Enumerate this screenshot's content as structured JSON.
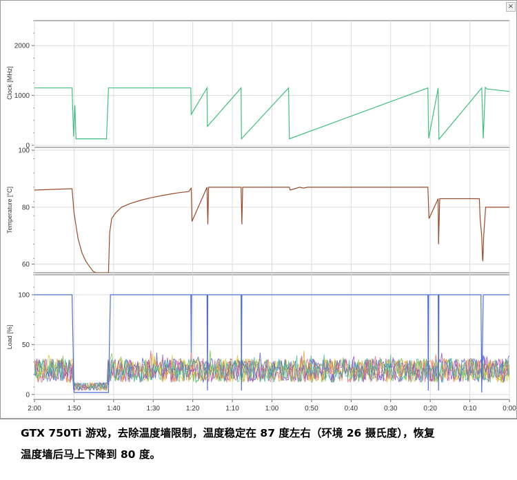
{
  "close_label": "×",
  "caption": {
    "line1": "GTX 750Ti 游戏，去除温度墙限制，温度稳定在 87 度左右（环境 26 摄氏度），恢复",
    "line2": "温度墙后马上下降到 80 度。"
  },
  "chart_data": [
    {
      "type": "line",
      "ylabel": "Clock [MHz]",
      "ylim": [
        0,
        2500
      ],
      "yticks": [
        0,
        1000,
        2000
      ],
      "color": "#3fbf7f",
      "x": [
        120,
        110.5,
        110.1,
        109.8,
        109.5,
        101.8,
        101.3,
        80.5,
        80.4,
        76.4,
        76.3,
        67.8,
        67.7,
        55.8,
        55.6,
        20.6,
        20.4,
        18.0,
        17.8,
        7.0,
        6.6,
        6.1,
        5.6,
        0
      ],
      "y": [
        1150,
        1150,
        180,
        800,
        130,
        130,
        1150,
        1150,
        620,
        1150,
        380,
        1150,
        130,
        1150,
        130,
        1150,
        140,
        1150,
        120,
        1150,
        140,
        1160,
        1130,
        1080
      ]
    },
    {
      "type": "line",
      "ylabel": "Temperature [°C]",
      "ylim": [
        57,
        101
      ],
      "yticks": [
        60,
        80,
        100
      ],
      "color": "#9a4a28",
      "x": [
        120,
        110.5,
        110.0,
        109.0,
        108.0,
        107.0,
        106.0,
        105.2,
        104.5,
        101.3,
        101.0,
        100.5,
        99.5,
        98.0,
        96.0,
        93.0,
        90.0,
        87.0,
        84.0,
        81.0,
        80.5,
        80.4,
        80.2,
        76.4,
        76.2,
        76.0,
        67.8,
        67.6,
        67.4,
        55.7,
        55.6,
        55.4,
        53.0,
        52.0,
        51.0,
        50.0,
        49.0,
        46.0,
        20.6,
        20.5,
        20.3,
        18.0,
        17.9,
        17.6,
        7.6,
        7.4,
        7.0,
        6.8,
        6.7,
        6.5,
        6.0,
        0
      ],
      "y": [
        86,
        86.5,
        78,
        69,
        64,
        61,
        59,
        57.5,
        57,
        57,
        71,
        76,
        78,
        80,
        81.2,
        82.5,
        83.5,
        84.3,
        85,
        85.5,
        86.5,
        86.8,
        75,
        87,
        74,
        87,
        87,
        74,
        87,
        87,
        87,
        86,
        87,
        86.7,
        87,
        87,
        87,
        87,
        87,
        83,
        76,
        83,
        67,
        83,
        83,
        76,
        70,
        62,
        61,
        70,
        80,
        80
      ]
    },
    {
      "type": "line",
      "ylabel": "Load [%]",
      "ylim": [
        -5,
        120
      ],
      "yticks": [
        0,
        50,
        100
      ],
      "color": "#4a6fd4",
      "noise_colors": [
        "#e8a030",
        "#7ac043",
        "#9b3fd0",
        "#d9c62e",
        "#4f5fcf",
        "#e86a7a",
        "#3fbfa0"
      ],
      "x": [
        120,
        110.5,
        110.0,
        101.3,
        100.8,
        80.5,
        80.4,
        80.3,
        76.4,
        76.3,
        76.2,
        67.8,
        67.7,
        67.6,
        20.6,
        20.5,
        20.4,
        18.0,
        17.9,
        17.8,
        7.2,
        7.0,
        6.6,
        6.4,
        0
      ],
      "y": [
        100,
        100,
        2,
        2,
        100,
        100,
        42,
        100,
        100,
        4,
        100,
        100,
        4,
        100,
        100,
        4,
        100,
        100,
        4,
        100,
        100,
        2,
        100,
        100,
        100
      ]
    }
  ],
  "x_axis": {
    "range_seconds": [
      120,
      0
    ],
    "tick_values": [
      120,
      110,
      100,
      90,
      80,
      70,
      60,
      50,
      40,
      30,
      20,
      10,
      0
    ],
    "tick_labels": [
      "2:00",
      "1:50",
      "1:40",
      "1:30",
      "1:20",
      "1:10",
      "1:00",
      "0:50",
      "0:40",
      "0:30",
      "0:20",
      "0:10",
      "0:00"
    ]
  }
}
